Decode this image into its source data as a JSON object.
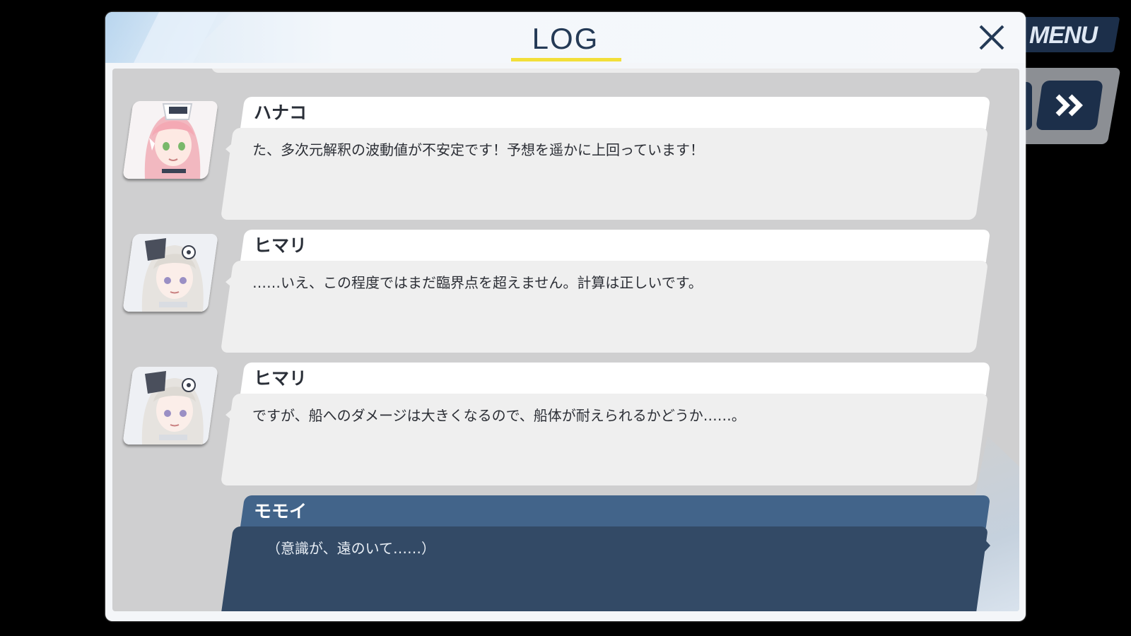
{
  "hud": {
    "menu_label": "MENU",
    "skip_icon": "double-chevron-right-icon"
  },
  "dialog": {
    "title": "LOG",
    "close_icon": "close-icon"
  },
  "entries": [
    {
      "speaker": "ハナコ",
      "portrait": "hanako-portrait",
      "message": "た、多次元解釈の波動値が不安定です！予想を遥かに上回っています！"
    },
    {
      "speaker": "ヒマリ",
      "portrait": "himari-portrait",
      "message": "……いえ、この程度ではまだ臨界点を超えません。計算は正しいです。"
    },
    {
      "speaker": "ヒマリ",
      "portrait": "himari-portrait",
      "message": "ですが、船へのダメージは大きくなるので、船体が耐えられるかどうか……。"
    },
    {
      "speaker": "モモイ",
      "message": "（意識が、遠のいて……）"
    }
  ],
  "colors": {
    "title_text": "#243a56",
    "title_underline": "#f2df3a",
    "player_name_bar": "#42648a",
    "player_bubble": "#334a66",
    "npc_bubble": "#efefef",
    "log_background": "#cfcfd0"
  }
}
